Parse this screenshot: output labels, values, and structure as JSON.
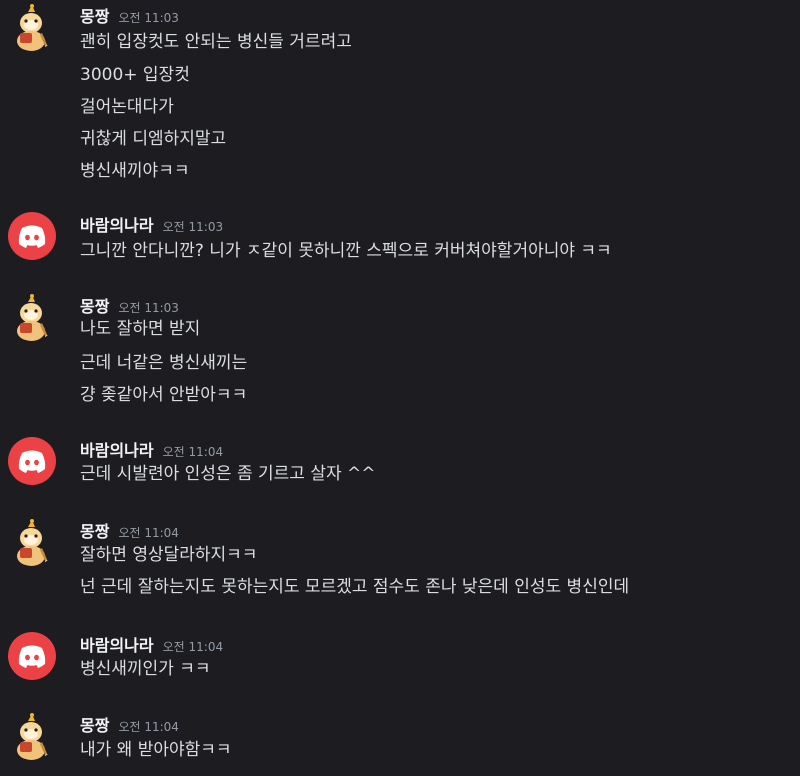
{
  "users": {
    "mongjjang": {
      "name": "몽짱",
      "avatar_icon": "hamster-avatar-icon"
    },
    "baram": {
      "name": "바람의나라",
      "avatar_icon": "discord-logo-icon",
      "avatar_color": "#ed4245"
    }
  },
  "messages": [
    {
      "author": "몽짱",
      "time": "오전 11:03",
      "lines": [
        "괜히 입장컷도 안되는 병신들 거르려고",
        "3000+ 입장컷",
        "걸어논대다가",
        "귀찮게 디엠하지말고",
        "병신새끼야ㅋㅋ"
      ]
    },
    {
      "author": "바람의나라",
      "time": "오전 11:03",
      "lines": [
        "그니깐 안다니깐? 니가 ㅈ같이 못하니깐 스펙으로 커버쳐야할거아니야 ㅋㅋ"
      ]
    },
    {
      "author": "몽짱",
      "time": "오전 11:03",
      "lines": [
        "나도 잘하면 받지",
        "근데 너같은 병신새끼는",
        "걍 좆같아서 안받아ㅋㅋ"
      ]
    },
    {
      "author": "바람의나라",
      "time": "오전 11:04",
      "lines": [
        "근데 시발련아 인성은 좀 기르고 살자 ^^"
      ]
    },
    {
      "author": "몽짱",
      "time": "오전 11:04",
      "lines": [
        "잘하면 영상달라하지ㅋㅋ",
        "넌 근데 잘하는지도 못하는지도 모르겠고 점수도 존나 낮은데 인성도 병신인데"
      ]
    },
    {
      "author": "바람의나라",
      "time": "오전 11:04",
      "lines": [
        "병신새끼인가 ㅋㅋ"
      ]
    },
    {
      "author": "몽짱",
      "time": "오전 11:04",
      "lines": [
        "내가 왜 받아야함ㅋㅋ"
      ]
    }
  ]
}
